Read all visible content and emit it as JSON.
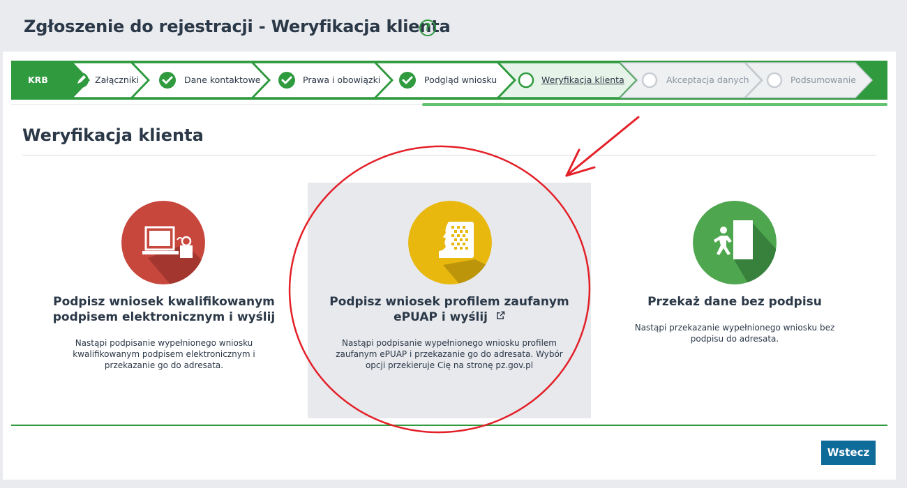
{
  "page": {
    "title": "Zgłoszenie do rejestracji - Weryfikacja klienta",
    "help_glyph": "?"
  },
  "stepper": {
    "start_label": "KRB",
    "steps": [
      {
        "label": "Załączniki",
        "state": "edit"
      },
      {
        "label": "Dane kontaktowe",
        "state": "done"
      },
      {
        "label": "Prawa i obowiązki",
        "state": "done"
      },
      {
        "label": "Podgląd wniosku",
        "state": "done"
      },
      {
        "label": "Weryfikacja klienta",
        "state": "active"
      },
      {
        "label": "Akceptacja danych",
        "state": "pending"
      },
      {
        "label": "Podsumowanie",
        "state": "pending"
      }
    ]
  },
  "section": {
    "title": "Weryfikacja klienta"
  },
  "options": [
    {
      "title_line1": "Podpisz wniosek kwalifikowanym",
      "title_line2": "podpisem elektronicznym i wyślij",
      "desc_line1": "Nastąpi podpisanie wypełnionego wniosku",
      "desc_line2": "kwalifikowanym podpisem elektronicznym i",
      "desc_line3": "przekazanie go do adresata.",
      "icon": "computer-signature-icon",
      "color": "#c8473d"
    },
    {
      "title_line1": "Podpisz wniosek profilem zaufanym",
      "title_line2": "ePUAP i wyślij",
      "desc_line1": "Nastąpi podpisanie wypełnionego wniosku profilem",
      "desc_line2": "zaufanym ePUAP i przekazanie go do adresata. Wybór",
      "desc_line3": "opcji przekieruje Cię na stronę pz.gov.pl",
      "icon": "trusted-profile-icon",
      "color": "#e8b80e"
    },
    {
      "title_line1": "Przekaż dane bez podpisu",
      "desc_line1": "Nastąpi przekazanie wypełnionego wniosku bez",
      "desc_line2": "podpisu do adresata.",
      "icon": "person-door-icon",
      "color": "#4ea64f"
    }
  ],
  "footer": {
    "back_label": "Wstecz"
  },
  "colors": {
    "accent_green": "#2f9a3e",
    "progress_green": "#63c26f",
    "button_blue": "#0f6b9a",
    "annotation_red": "#e32028"
  }
}
